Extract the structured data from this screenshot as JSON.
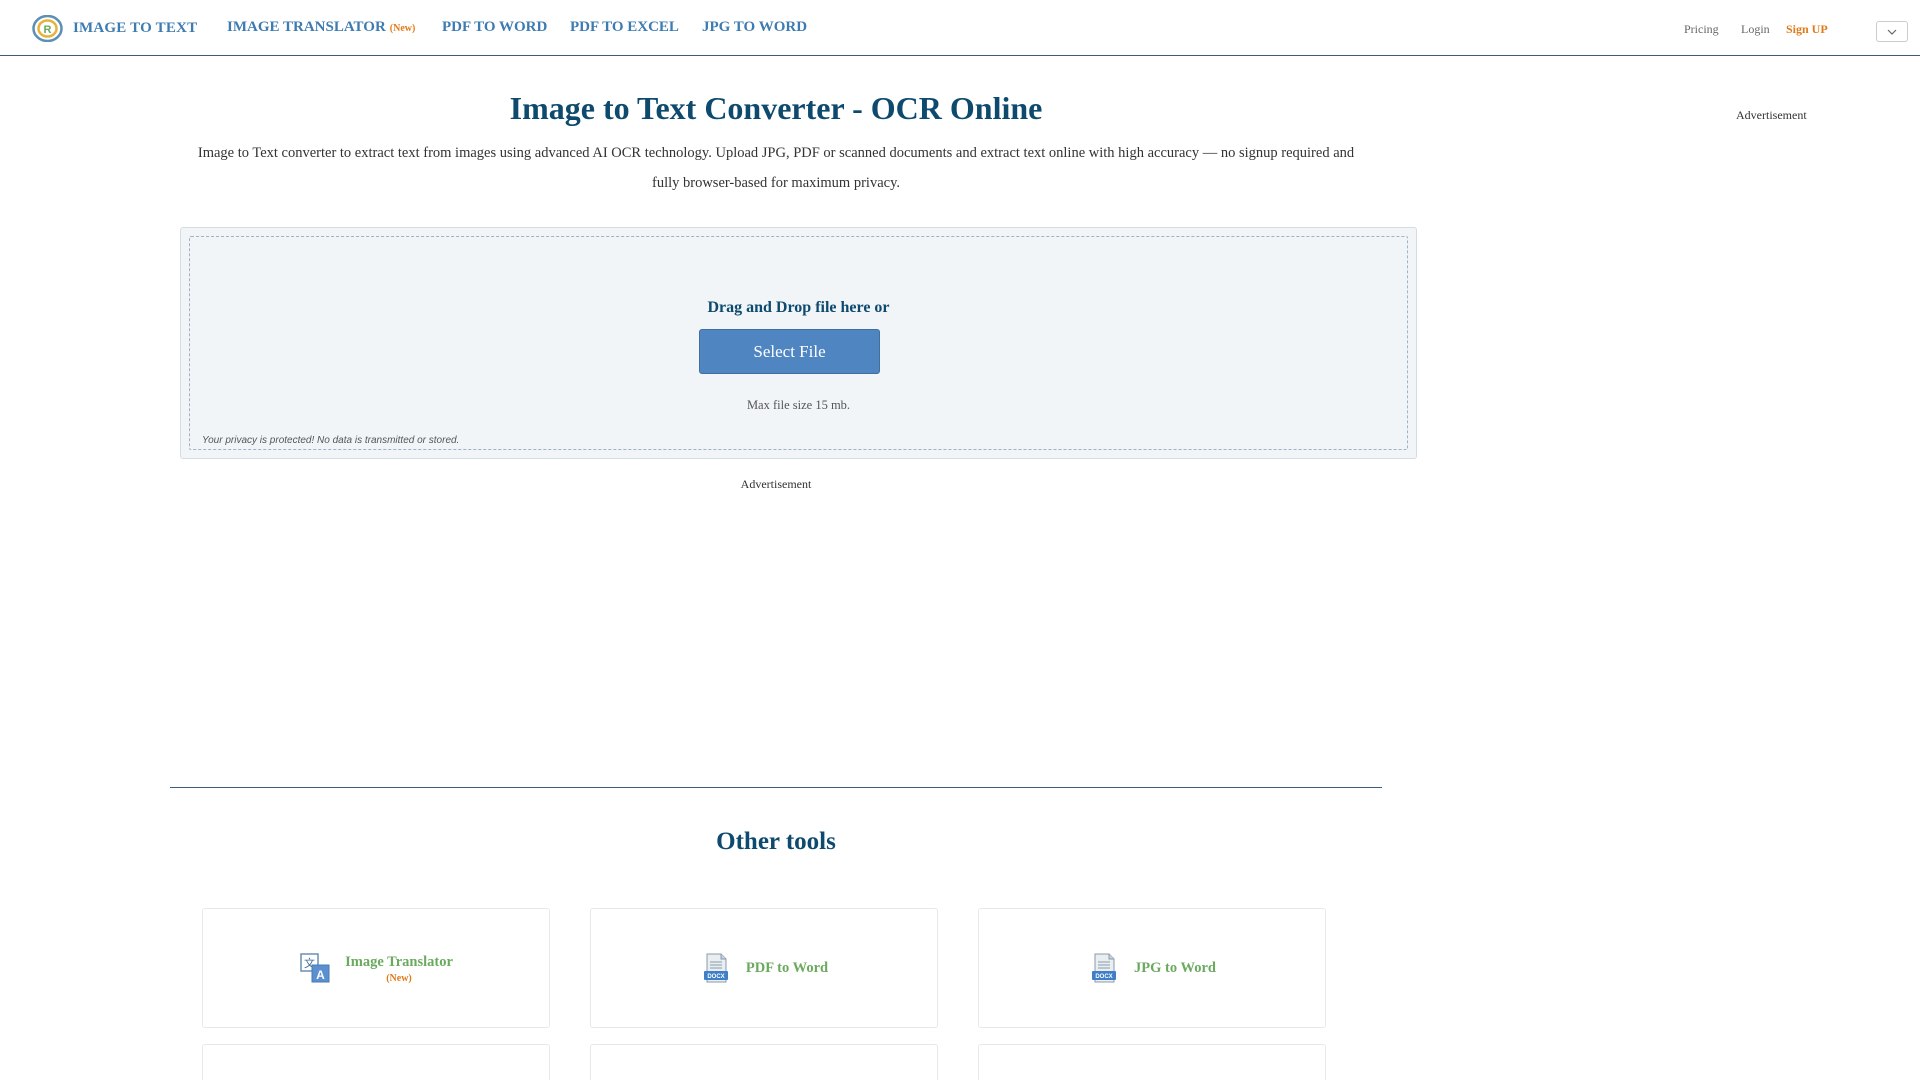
{
  "header": {
    "logo_text": "IMAGE TO TEXT",
    "nav": [
      {
        "label": "IMAGE TRANSLATOR",
        "badge": "(New)"
      },
      {
        "label": "PDF TO WORD"
      },
      {
        "label": "PDF TO EXCEL"
      },
      {
        "label": "JPG TO WORD"
      }
    ],
    "pricing": "Pricing",
    "login": "Login",
    "signup": "Sign UP"
  },
  "main": {
    "title": "Image to Text Converter - OCR Online",
    "description": "Image to Text converter to extract text from images using advanced AI OCR technology. Upload JPG, PDF or scanned documents and extract text online with high accuracy — no signup required and fully browser-based for maximum privacy.",
    "ad_right": "Advertisement",
    "ad_center": "Advertisement"
  },
  "upload": {
    "drag_text": "Drag and Drop file here or",
    "button_label": "Select File",
    "max_size": "Max file size 15 mb.",
    "privacy": "Your privacy is protected! No data is transmitted or stored."
  },
  "other_tools": {
    "title": "Other tools",
    "items": [
      {
        "label": "Image Translator",
        "badge": "(New)",
        "icon": "translate-icon"
      },
      {
        "label": "PDF to Word",
        "icon": "docx-file-icon"
      },
      {
        "label": "JPG to Word",
        "icon": "docx-file-icon"
      }
    ]
  },
  "colors": {
    "brand_blue": "#3e7bb0",
    "title_navy": "#0d4a6e",
    "accent_orange": "#e07b1a",
    "tool_green": "#6aaa5e",
    "button_blue": "#4f86c2"
  }
}
